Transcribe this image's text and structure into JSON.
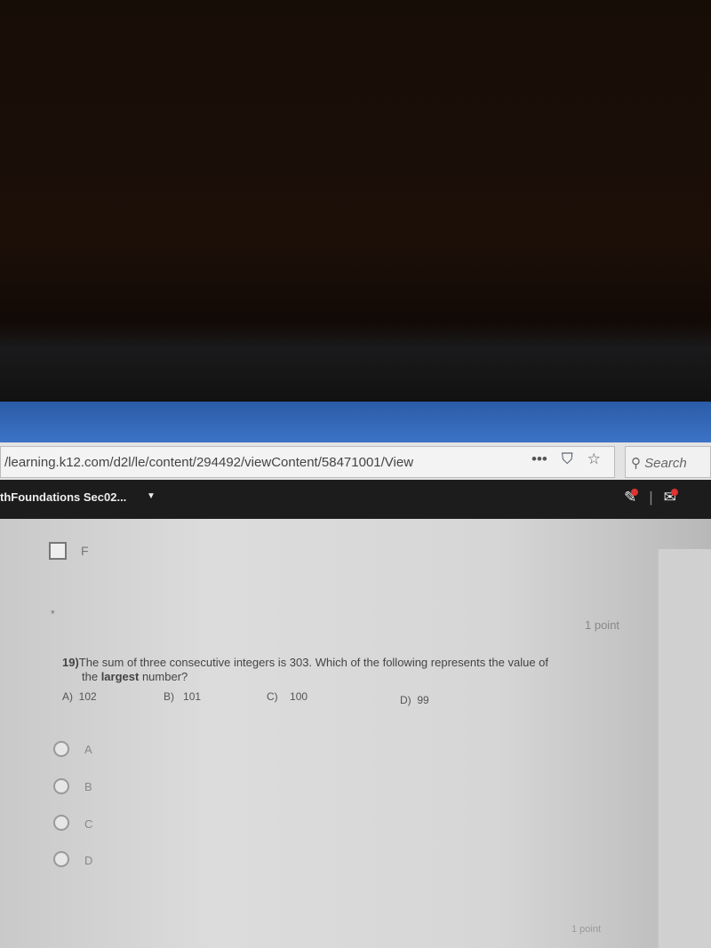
{
  "browser": {
    "url": "/learning.k12.com/d2l/le/content/294492/viewContent/58471001/View",
    "search_placeholder": "Search",
    "icons": [
      "more-icon",
      "pocket-icon",
      "star-icon",
      "search-icon"
    ]
  },
  "nav": {
    "course": "thFoundations Sec02...",
    "icons": [
      "notifications-icon",
      "messages-icon"
    ]
  },
  "previous": {
    "option_label": "F"
  },
  "question": {
    "required_marker": "*",
    "points": "1 point",
    "number": "19)",
    "text": "The sum of three consecutive integers is 303.  Which of the following represents the value of",
    "text2_pre": "the ",
    "text2_bold": "largest",
    "text2_post": " number?",
    "choices": [
      {
        "letter": "A)",
        "value": "102"
      },
      {
        "letter": "B)",
        "value": "101"
      },
      {
        "letter": "C)",
        "value": "100"
      },
      {
        "letter": "D)",
        "value": "99"
      }
    ],
    "options": [
      "A",
      "B",
      "C",
      "D"
    ]
  },
  "next": {
    "points": "1 point"
  }
}
